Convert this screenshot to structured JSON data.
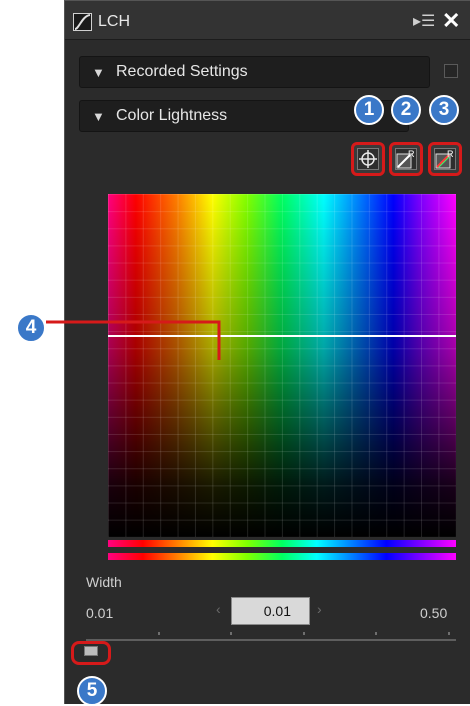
{
  "window": {
    "title": "LCH"
  },
  "sections": {
    "recorded": "Recorded Settings",
    "color_lightness": "Color Lightness"
  },
  "tools": [
    {
      "name": "target-picker",
      "icon": "crosshair-icon"
    },
    {
      "name": "reset-channel",
      "icon": "reset-r-icon"
    },
    {
      "name": "reset-all",
      "icon": "reset-r-color-icon"
    }
  ],
  "callouts": [
    "1",
    "2",
    "3",
    "4",
    "5"
  ],
  "width": {
    "label": "Width",
    "min": "0.01",
    "max": "0.50",
    "value": "0.01"
  },
  "chart_data": {
    "type": "heatmap",
    "title": "",
    "xlabel": "",
    "ylabel": "",
    "curve_level": 0.5
  },
  "colors": {
    "panel_bg": "#2b2b2b",
    "highlight": "#d61a1a",
    "callout": "#3a78c8"
  }
}
